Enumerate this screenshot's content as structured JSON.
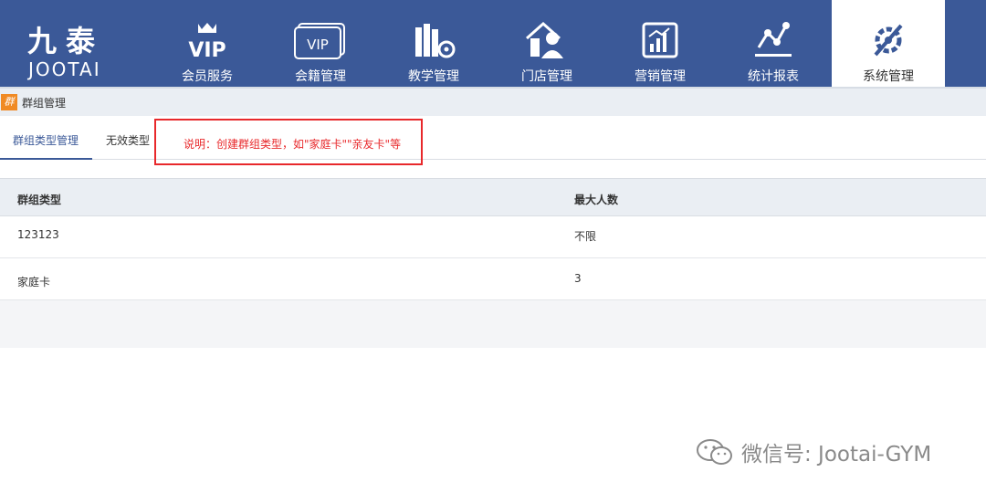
{
  "logo": {
    "cn": "九泰",
    "en": "JOOTAI"
  },
  "nav": [
    {
      "label": "会员服务",
      "icon": "vip-crown-icon"
    },
    {
      "label": "会籍管理",
      "icon": "vip-card-icon"
    },
    {
      "label": "教学管理",
      "icon": "books-gear-icon"
    },
    {
      "label": "门店管理",
      "icon": "store-person-icon"
    },
    {
      "label": "营销管理",
      "icon": "chart-board-icon"
    },
    {
      "label": "统计报表",
      "icon": "line-chart-icon"
    },
    {
      "label": "系统管理",
      "icon": "tools-icon",
      "active": true
    }
  ],
  "breadcrumb": {
    "icon_text": "群",
    "label": "群组管理"
  },
  "tabs": [
    {
      "label": "群组类型管理",
      "active": true
    },
    {
      "label": "无效类型",
      "active": false
    }
  ],
  "note": "说明：创建群组类型，如\"家庭卡\"\"亲友卡\"等",
  "table": {
    "columns": [
      "群组类型",
      "最大人数"
    ],
    "rows": [
      [
        "123123",
        "不限"
      ],
      [
        "家庭卡",
        "3"
      ]
    ]
  },
  "watermark": "微信号: Jootai-GYM",
  "colors": {
    "nav_bg": "#3b5998",
    "accent": "#3b5998",
    "note_red": "#e8282b",
    "breadcrumb_icon": "#f08a24"
  }
}
